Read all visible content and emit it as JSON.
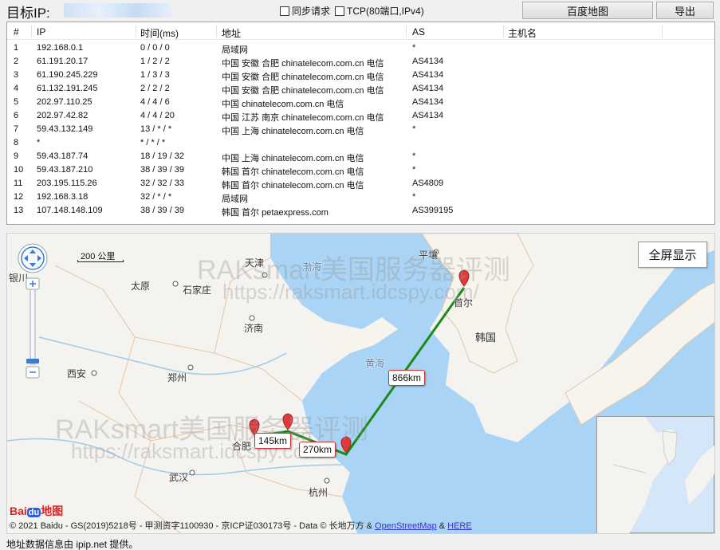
{
  "topbar": {
    "target_label": "目标IP:",
    "sync_label": "同步请求",
    "tcp_label": "TCP(80端口,IPv4)",
    "baidu_map_button": "百度地图",
    "export_button": "导出"
  },
  "table": {
    "headers": [
      "#",
      "IP",
      "时间(ms)",
      "地址",
      "AS",
      "主机名"
    ],
    "rows": [
      {
        "n": "1",
        "ip": "192.168.0.1",
        "time": "0 / 0 / 0",
        "addr": "局域网",
        "as": "*"
      },
      {
        "n": "2",
        "ip": "61.191.20.17",
        "time": "1 / 2 / 2",
        "addr": "中国 安徽 合肥 chinatelecom.com.cn 电信",
        "as": "AS4134"
      },
      {
        "n": "3",
        "ip": "61.190.245.229",
        "time": "1 / 3 / 3",
        "addr": "中国 安徽 合肥 chinatelecom.com.cn 电信",
        "as": "AS4134"
      },
      {
        "n": "4",
        "ip": "61.132.191.245",
        "time": "2 / 2 / 2",
        "addr": "中国 安徽 合肥 chinatelecom.com.cn 电信",
        "as": "AS4134"
      },
      {
        "n": "5",
        "ip": "202.97.110.25",
        "time": "4 / 4 / 6",
        "addr": "中国 chinatelecom.com.cn 电信",
        "as": "AS4134"
      },
      {
        "n": "6",
        "ip": "202.97.42.82",
        "time": "4 / 4 / 20",
        "addr": "中国 江苏 南京 chinatelecom.com.cn 电信",
        "as": "AS4134"
      },
      {
        "n": "7",
        "ip": "59.43.132.149",
        "time": "13 / * / *",
        "addr": "中国 上海 chinatelecom.com.cn 电信",
        "as": "*"
      },
      {
        "n": "8",
        "ip": "*",
        "time": "* / * / *",
        "addr": "",
        "as": ""
      },
      {
        "n": "9",
        "ip": "59.43.187.74",
        "time": "18 / 19 / 32",
        "addr": "中国 上海 chinatelecom.com.cn 电信",
        "as": "*"
      },
      {
        "n": "10",
        "ip": "59.43.187.210",
        "time": "38 / 39 / 39",
        "addr": "韩国 首尔 chinatelecom.com.cn 电信",
        "as": "*"
      },
      {
        "n": "11",
        "ip": "203.195.115.26",
        "time": "32 / 32 / 33",
        "addr": "韩国 首尔 chinatelecom.com.cn 电信",
        "as": "AS4809"
      },
      {
        "n": "12",
        "ip": "192.168.3.18",
        "time": "32 / * / *",
        "addr": "局域网",
        "as": "*"
      },
      {
        "n": "13",
        "ip": "107.148.148.109",
        "time": "38 / 39 / 39",
        "addr": "韩国 首尔 petaexpress.com",
        "as": "AS399195"
      }
    ]
  },
  "map": {
    "fullscreen_button": "全屏显示",
    "scale": "200 公里",
    "labels": {
      "tianjin": "天津",
      "bohai": "渤海",
      "pingrang": "平壤",
      "beijing_partial": "银川",
      "taiyuan": "太原",
      "shijiazhuang": "石家庄",
      "jinan": "济南",
      "seoul": "首尔",
      "korea": "韩国",
      "huanghai": "黄海",
      "xian": "西安",
      "zhengzhou": "郑州",
      "hefei": "合肥",
      "wuhan": "武汉",
      "hangzhou": "杭州"
    },
    "distances": {
      "d1": "145km",
      "d2": "270km",
      "d3": "866km"
    },
    "watermark_text": "RAKsmart美国服务器评测",
    "watermark_url": "https://raksmart.idcspy.com/",
    "copyright_prefix": "© 2021 Baidu - GS(2019)5218号 - 甲测资字1100930 - 京ICP证030173号 - Data © 长地万方 & ",
    "osm_link": "OpenStreetMap",
    "copyright_amp": " & ",
    "here_link": "HERE",
    "logo_text": "Bai",
    "logo_paw": "du",
    "logo_suffix": "地图",
    "route_color": "#1a8a1a",
    "pin_color": "#e0393b"
  },
  "footer": "地址数据信息由 ipip.net 提供。"
}
